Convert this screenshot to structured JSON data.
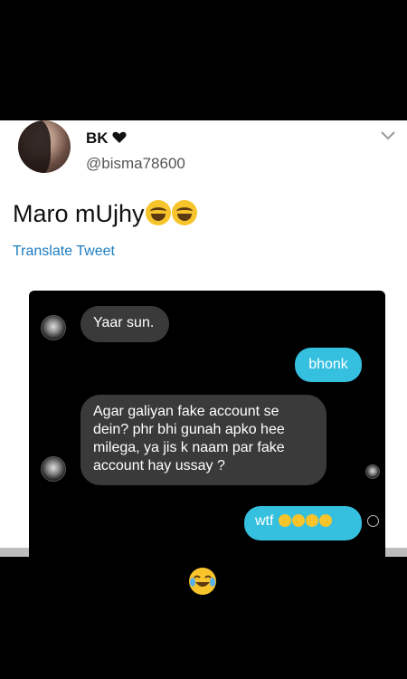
{
  "tweet": {
    "display_name": "BK",
    "display_name_emoji": "heart-icon",
    "handle": "@bisma78600",
    "text": "Maro mUjhy",
    "text_emojis": [
      "laughing-tears-icon",
      "laughing-tears-icon"
    ],
    "translate_label": "Translate Tweet"
  },
  "chat": {
    "messages": [
      {
        "side": "in",
        "text": "Yaar sun."
      },
      {
        "side": "out",
        "text": "bhonk"
      },
      {
        "side": "in",
        "text": "Agar galiyan fake account se dein? phr bhi gunah apko hee milega, ya jis k naam par fake account hay ussay ?"
      },
      {
        "side": "out",
        "text": "wtf",
        "emojis": [
          "laughing-tears-icon",
          "laughing-tears-icon",
          "laughing-tears-icon",
          "laughing-tears-icon"
        ]
      }
    ]
  },
  "colors": {
    "link": "#1d7cc0",
    "outgoing_bubble": "#35c0e0",
    "incoming_bubble": "#3a3a3a"
  },
  "bottom_emoji": "laughing-tears-icon"
}
